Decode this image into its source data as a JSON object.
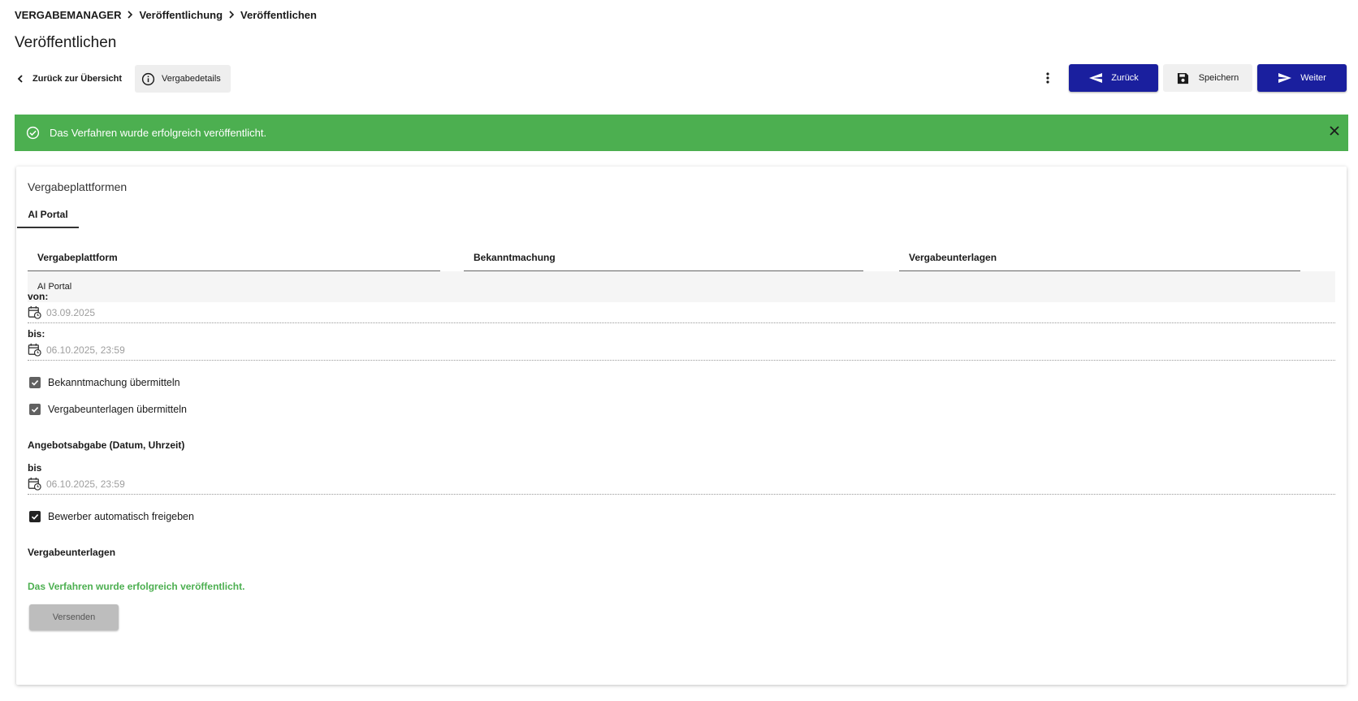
{
  "breadcrumb": {
    "items": [
      "VERGABEMANAGER",
      "Veröffentlichung",
      "Veröffentlichen"
    ]
  },
  "page": {
    "title": "Veröffentlichen"
  },
  "toolbar": {
    "back_to_overview": "Zurück zur Übersicht",
    "details": "Vergabedetails",
    "back": "Zurück",
    "save": "Speichern",
    "next": "Weiter"
  },
  "alert": {
    "message": "Das Verfahren wurde erfolgreich veröffentlicht."
  },
  "card": {
    "title": "Vergabeplattformen",
    "tabs": [
      "AI Portal"
    ],
    "table": {
      "headers": [
        "Vergabeplattform",
        "Bekanntmachung",
        "Vergabeunterlagen"
      ],
      "rows": [
        [
          "AI Portal",
          "",
          ""
        ]
      ]
    },
    "von_label": "von:",
    "von_value": "03.09.2025",
    "bis_label": "bis:",
    "bis_value": "06.10.2025, 23:59",
    "checkbox_notice": "Bekanntmachung übermitteln",
    "checkbox_docs": "Vergabeunterlagen übermitteln",
    "offer_heading": "Angebotsabgabe (Datum, Uhrzeit)",
    "offer_bis_label": "bis",
    "offer_bis_value": "06.10.2025, 23:59",
    "checkbox_auto": "Bewerber automatisch freigeben",
    "docs_heading": "Vergabeunterlagen",
    "success_text": "Das Verfahren wurde erfolgreich veröffentlicht.",
    "send_button": "Versenden"
  },
  "colors": {
    "primary": "#1a1f9e",
    "success": "#4caf50"
  }
}
